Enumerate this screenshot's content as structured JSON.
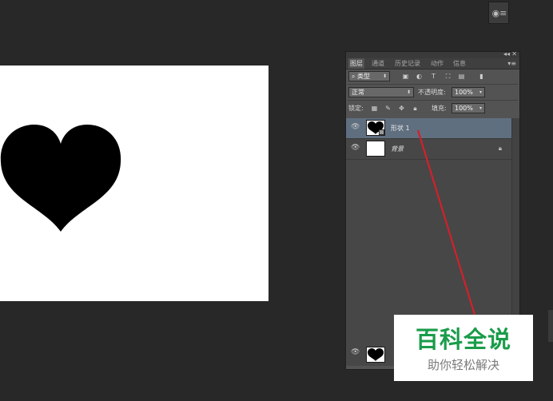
{
  "canvas": {
    "shape": "heart-shape",
    "shape_color": "#000000",
    "background": "#ffffff"
  },
  "dock_button": {
    "icon": "panel-icon"
  },
  "panel": {
    "tabs": [
      "图层",
      "通道",
      "历史记录",
      "动作",
      "信息"
    ],
    "active_tab": 0,
    "filter": {
      "label": "类型",
      "icon": "search-icon"
    },
    "blend_mode": "正常",
    "opacity": {
      "label": "不透明度:",
      "value": "100%"
    },
    "lock": {
      "label": "锁定:"
    },
    "fill": {
      "label": "填充:",
      "value": "100%"
    },
    "layers": [
      {
        "name": "形状 1",
        "selected": true,
        "thumbnail": "heart",
        "locked": false
      },
      {
        "name": "背景",
        "selected": false,
        "thumbnail": "white",
        "locked": true
      }
    ]
  },
  "annotation": {
    "color": "#d3202c"
  },
  "watermark": {
    "title": "百科全说",
    "subtitle": "助你轻松解决"
  },
  "colors": {
    "accent_selected": "#5f6f80",
    "watermark_green": "#1a9c4a"
  }
}
